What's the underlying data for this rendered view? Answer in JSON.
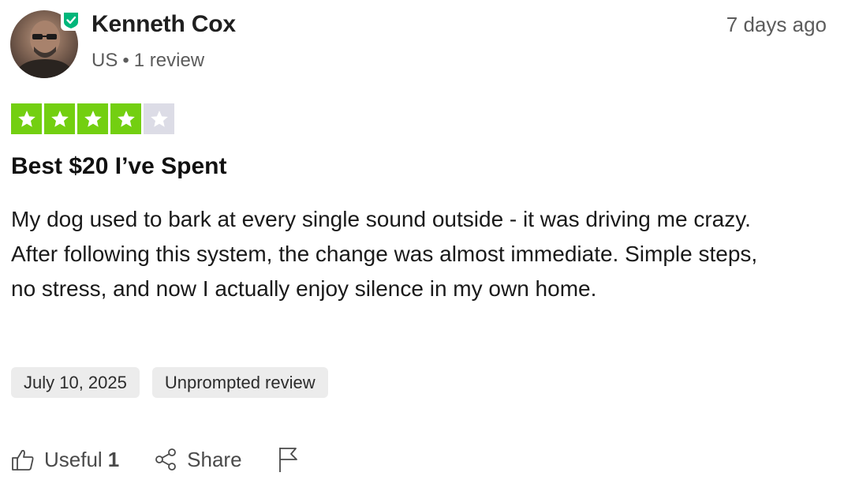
{
  "reviewer": {
    "name": "Kenneth Cox",
    "country": "US",
    "separator": "•",
    "review_count": "1 review",
    "avatar_icon": "avatar-photo",
    "verified_icon": "verified-shield-icon"
  },
  "review": {
    "time_ago": "7 days ago",
    "rating": 4,
    "rating_max": 5,
    "title": "Best $20 I’ve Spent",
    "body": "My dog used to bark at every single sound outside - it was driving me crazy. After following this system, the change was almost immediate. Simple steps, no stress, and now I actually enjoy silence in my own home.",
    "date_chip": "July 10, 2025",
    "type_chip": "Unprompted review"
  },
  "actions": {
    "useful_label": "Useful",
    "useful_count": "1",
    "share_label": "Share"
  },
  "colors": {
    "star_on": "#73cf11",
    "star_off": "#dcdce6",
    "verified": "#00b67a",
    "chip_bg": "#ececec"
  }
}
